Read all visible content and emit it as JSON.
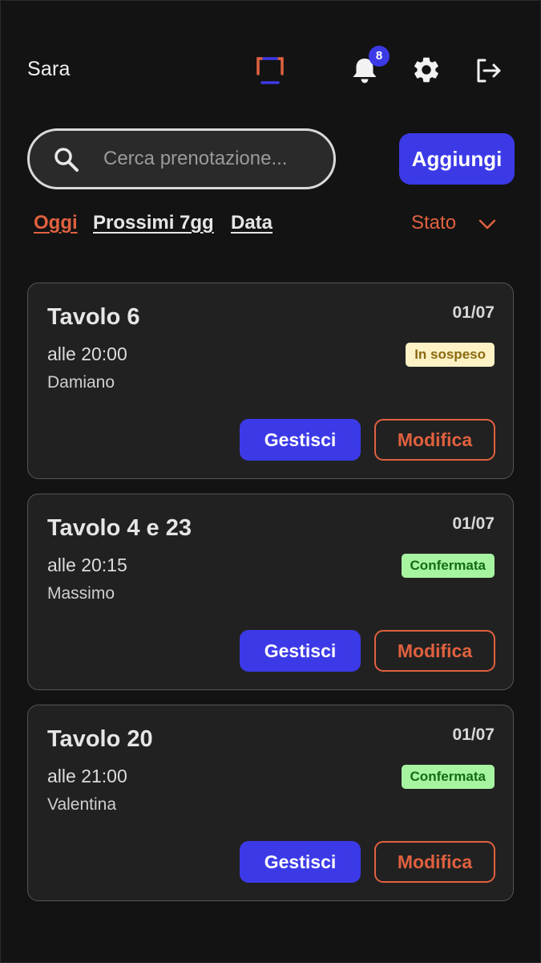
{
  "header": {
    "user_name": "Sara",
    "notifications_count": "8",
    "accent_color": "#e0613f",
    "primary_color": "#3c3ae7"
  },
  "search": {
    "placeholder": "Cerca prenotazione...",
    "value": "",
    "icon": "search-icon"
  },
  "actions": {
    "add_label": "Aggiungi"
  },
  "filters": {
    "items": [
      {
        "label": "Oggi",
        "active": true
      },
      {
        "label": "Prossimi 7gg",
        "active": false
      },
      {
        "label": "Data",
        "active": false
      }
    ],
    "status_label": "Stato"
  },
  "reservations": [
    {
      "table": "Tavolo 6",
      "date": "01/07",
      "time": "alle 20:00",
      "name": "Damiano",
      "status": "In sospeso",
      "status_color": "#fdf1c6",
      "manage_label": "Gestisci",
      "edit_label": "Modifica"
    },
    {
      "table": "Tavolo 4 e 23",
      "date": "01/07",
      "time": "alle 20:15",
      "name": "Massimo",
      "status": "Confermata",
      "status_color": "#a6f4a0",
      "manage_label": "Gestisci",
      "edit_label": "Modifica"
    },
    {
      "table": "Tavolo 20",
      "date": "01/07",
      "time": "alle 21:00",
      "name": "Valentina",
      "status": "Confermata",
      "status_color": "#a6f4a0",
      "manage_label": "Gestisci",
      "edit_label": "Modifica"
    }
  ]
}
